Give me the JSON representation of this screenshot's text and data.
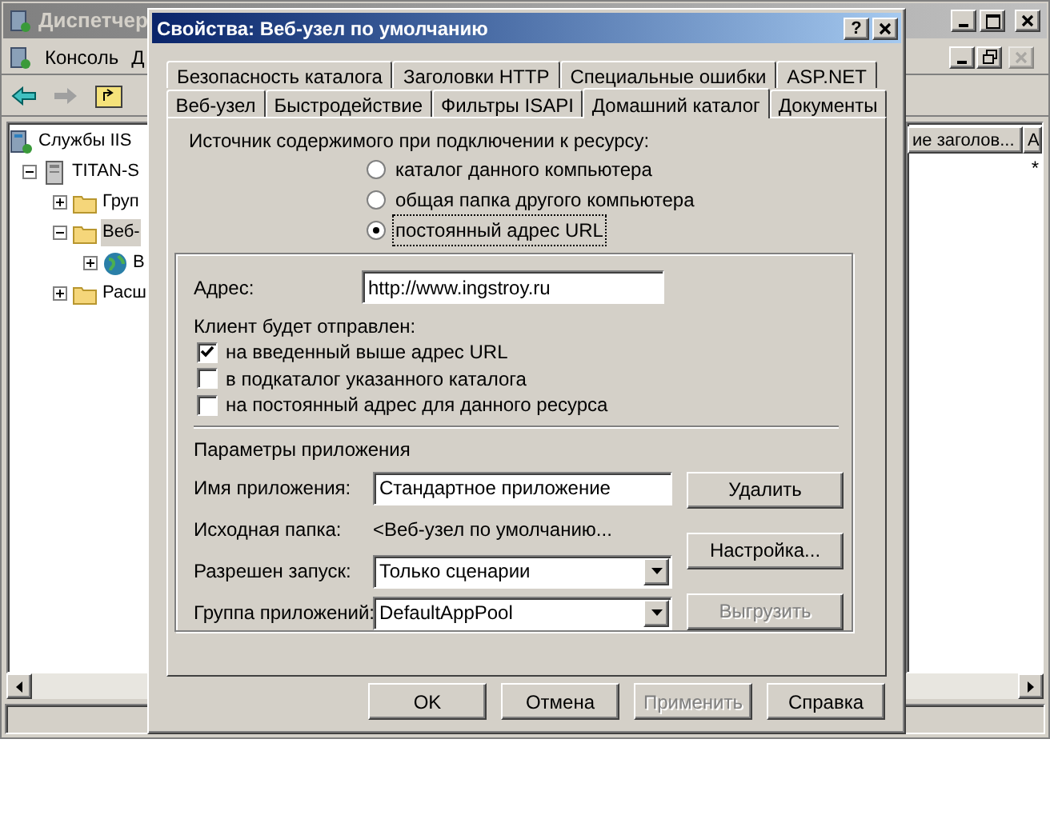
{
  "main_window": {
    "title": "Диспетчер",
    "menu": [
      {
        "label": "Консоль"
      },
      {
        "label": "Д"
      }
    ],
    "tree": [
      {
        "label": "Службы IIS",
        "kind": "services",
        "selected": false,
        "children": [
          {
            "label": "TITAN-S",
            "kind": "server",
            "expanded": true,
            "selected": false,
            "children": [
              {
                "label": "Груп",
                "kind": "folder",
                "expanded": false,
                "selected": false
              },
              {
                "label": "Веб-",
                "kind": "folder",
                "expanded": true,
                "selected": true,
                "children": [
                  {
                    "label": "В",
                    "kind": "globe",
                    "expanded": false,
                    "selected": false
                  }
                ]
              },
              {
                "label": "Расш",
                "kind": "folder",
                "expanded": false,
                "selected": false
              }
            ]
          }
        ]
      }
    ],
    "list": {
      "columns": [
        "ие заголов...",
        "А"
      ],
      "rows": [
        [
          "",
          "*"
        ]
      ]
    }
  },
  "dialog": {
    "title": "Свойства: Веб-узел по умолчанию",
    "help_button": "?",
    "tab_rows": [
      [
        {
          "label": "Безопасность каталога",
          "selected": false
        },
        {
          "label": "Заголовки HTTP",
          "selected": false
        },
        {
          "label": "Специальные ошибки",
          "selected": false
        },
        {
          "label": "ASP.NET",
          "selected": false
        }
      ],
      [
        {
          "label": "Веб-узел",
          "selected": false
        },
        {
          "label": "Быстродействие",
          "selected": false
        },
        {
          "label": "Фильтры ISAPI",
          "selected": false
        },
        {
          "label": "Домашний каталог",
          "selected": true
        },
        {
          "label": "Документы",
          "selected": false
        }
      ]
    ],
    "source_label": "Источник содержимого при подключении к ресурсу:",
    "source_options": [
      {
        "label": "каталог данного компьютера",
        "selected": false
      },
      {
        "label": "общая папка другого компьютера",
        "selected": false
      },
      {
        "label": "постоянный адрес URL",
        "selected": true
      }
    ],
    "address": {
      "label": "Адрес:",
      "value": "http://www.ingstroy.ru"
    },
    "redirect_label": "Клиент будет отправлен:",
    "redirect_options": [
      {
        "label": "на введенный выше адрес URL",
        "checked": true
      },
      {
        "label": "в подкаталог указанного каталога",
        "checked": false
      },
      {
        "label": "на постоянный адрес для данного ресурса",
        "checked": false
      }
    ],
    "app_settings": {
      "title": "Параметры приложения",
      "fields": [
        {
          "kind": "input",
          "label": "Имя приложения:",
          "value": "Стандартное приложение"
        },
        {
          "kind": "text",
          "label": "Исходная папка:",
          "value": "<Веб-узел по умолчанию..."
        },
        {
          "kind": "select",
          "label": "Разрешен запуск:",
          "value": "Только сценарии"
        },
        {
          "kind": "select",
          "label": "Группа приложений:",
          "value": "DefaultAppPool"
        }
      ],
      "buttons": [
        {
          "label": "Удалить",
          "disabled": false
        },
        {
          "label": "Настройка...",
          "disabled": false
        },
        {
          "label": "Выгрузить",
          "disabled": true
        }
      ]
    },
    "buttons": [
      {
        "label": "OK",
        "disabled": false
      },
      {
        "label": "Отмена",
        "disabled": false
      },
      {
        "label": "Применить",
        "disabled": true
      },
      {
        "label": "Справка",
        "disabled": false
      }
    ]
  }
}
